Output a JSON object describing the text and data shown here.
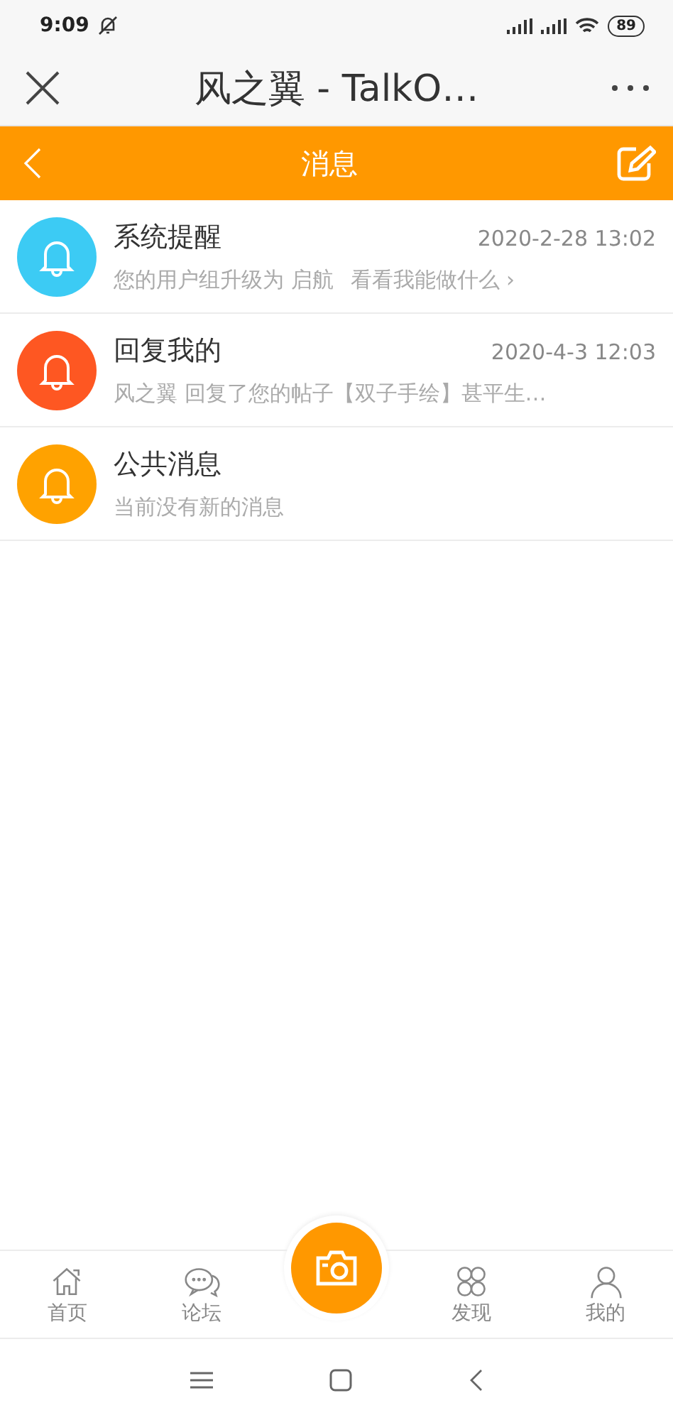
{
  "status_bar": {
    "time": "9:09",
    "battery": "89"
  },
  "browser": {
    "title": "风之翼 - TalkO…"
  },
  "header": {
    "title": "消息"
  },
  "messages": [
    {
      "title": "系统提醒",
      "time": "2020-2-28 13:02",
      "preview": "您的用户组升级为 启航",
      "link": "看看我能做什么 ›",
      "color": "#3ccbf4"
    },
    {
      "title": "回复我的",
      "time": "2020-4-3 12:03",
      "preview": "风之翼 回复了您的帖子【双子手绘】甚平生…",
      "color": "#fe5722"
    },
    {
      "title": "公共消息",
      "preview": "当前没有新的消息",
      "color": "#ffa200"
    }
  ],
  "tabs": [
    {
      "kind": "home",
      "label": "首页"
    },
    {
      "kind": "forum",
      "label": "论坛"
    },
    {
      "kind": "camera"
    },
    {
      "kind": "discover",
      "label": "发现"
    },
    {
      "kind": "me",
      "label": "我的"
    }
  ]
}
